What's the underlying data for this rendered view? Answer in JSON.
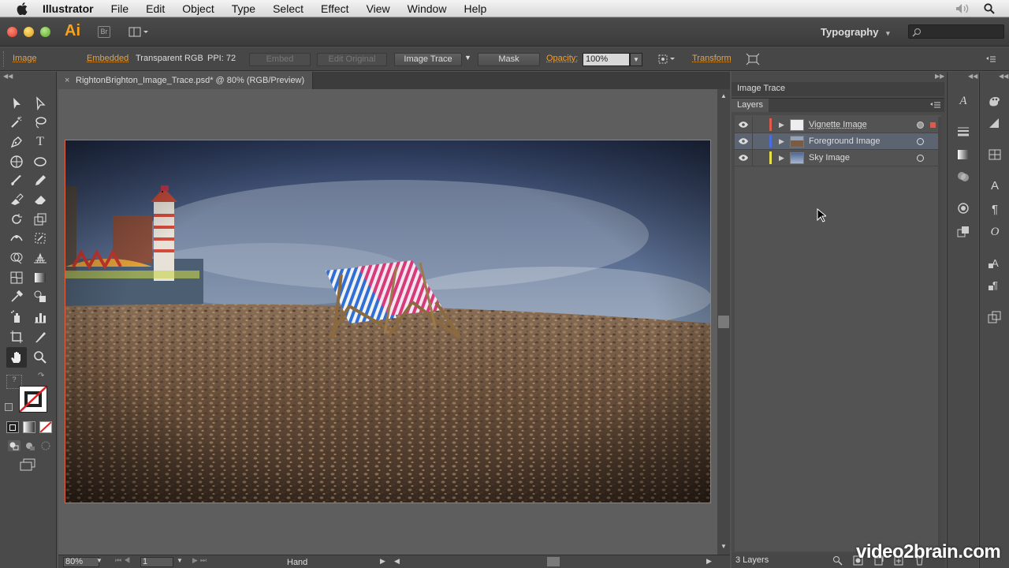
{
  "menubar": {
    "app": "Illustrator",
    "items": [
      "File",
      "Edit",
      "Object",
      "Type",
      "Select",
      "Effect",
      "View",
      "Window",
      "Help"
    ],
    "icons": [
      "apple-icon",
      "volume-icon",
      "spotlight-icon"
    ]
  },
  "appbar": {
    "logo": "Ai",
    "bridge": "Br",
    "workspace": "Typography"
  },
  "controlbar": {
    "object_type": "Image",
    "embedded": "Embedded",
    "color_mode": "Transparent RGB",
    "ppi": "PPI: 72",
    "embed_button": "Embed",
    "edit_original_button": "Edit Original",
    "image_trace_button": "Image Trace",
    "mask_button": "Mask",
    "opacity_label": "Opacity:",
    "opacity_value": "100%",
    "transform_label": "Transform"
  },
  "document": {
    "tab_title": "RightonBrighton_Image_Trace.psd* @ 80% (RGB/Preview)",
    "zoom": "80%",
    "artboard": "1",
    "status": "Hand"
  },
  "panels": {
    "image_trace_tab": "Image Trace",
    "layers_title": "Layers",
    "layers": [
      {
        "name": "Vignette Image",
        "color": "#e05a4a",
        "selected": false
      },
      {
        "name": "Foreground Image",
        "color": "#4a6ee0",
        "selected": true
      },
      {
        "name": "Sky Image",
        "color": "#e8e04a",
        "selected": false
      }
    ],
    "layer_count": "3 Layers"
  },
  "watermark": "video2brain.com"
}
